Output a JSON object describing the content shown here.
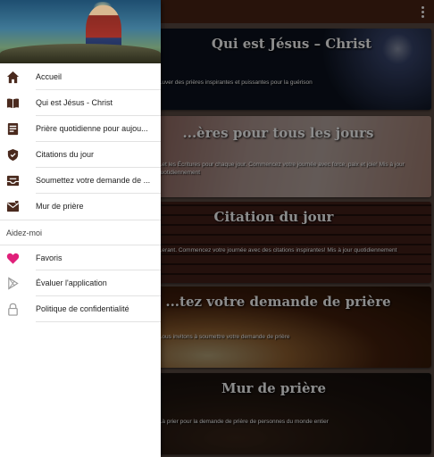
{
  "appbar": {
    "overflow_icon": "more-vert-icon"
  },
  "cards": [
    {
      "title": "Qui est Jésus – Christ",
      "desc": "...uver des prières inspirantes et puissantes pour la guérison"
    },
    {
      "title": "...ères pour tous les jours",
      "desc": "...et les Écritures pour chaque jour. Commencez votre journée avec force, paix et joie! Mis à jour quotidiennement"
    },
    {
      "title": "Citation du jour",
      "desc": "...erant. Commencez votre journée avec des citations inspirantes! Mis à jour quotidiennement"
    },
    {
      "title": "...tez votre demande de prière",
      "desc": "...ous invitons à soumettre votre demande de prière"
    },
    {
      "title": "Mur de prière",
      "desc": "...à prier pour la demande de prière de personnes du monde entier"
    }
  ],
  "drawer": {
    "items": [
      {
        "label": "Accueil",
        "icon": "home-icon"
      },
      {
        "label": "Qui est Jésus - Christ",
        "icon": "book-icon"
      },
      {
        "label": "Prière quotidienne pour aujou...",
        "icon": "note-icon"
      },
      {
        "label": "Citations du jour",
        "icon": "shield-icon"
      },
      {
        "label": "Soumettez votre demande de ...",
        "icon": "inbox-icon"
      },
      {
        "label": "Mur de prière",
        "icon": "mail-heart-icon"
      }
    ],
    "section_title": "Aidez-moi",
    "help_items": [
      {
        "label": "Favoris",
        "icon": "heart-icon"
      },
      {
        "label": "Évaluer l'application",
        "icon": "play-store-icon"
      },
      {
        "label": "Politique de confidentialité",
        "icon": "lock-icon"
      }
    ]
  },
  "colors": {
    "appbar": "#4a2414",
    "icon_dark": "#4a2a1e",
    "favorite": "#e0207a"
  }
}
